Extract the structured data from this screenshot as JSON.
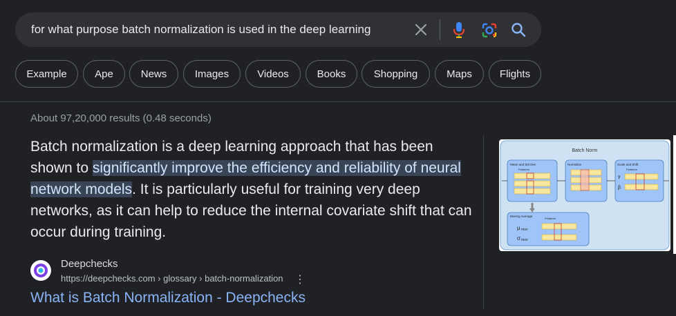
{
  "search": {
    "query": "for what purpose batch normalization is used in the deep learning",
    "clear_icon": "close-icon",
    "voice_icon": "mic-icon",
    "lens_icon": "lens-icon",
    "search_icon": "search-icon"
  },
  "chips": [
    "Example",
    "Ape",
    "News",
    "Images",
    "Videos",
    "Books",
    "Shopping",
    "Maps",
    "Flights"
  ],
  "results_stats": "About 97,20,000 results (0.48 seconds)",
  "featured_snippet": {
    "text_before": "Batch normalization is a deep learning approach that has been shown to ",
    "highlight": "significantly improve the efficiency and reliability of neural network models",
    "text_after": ". It is particularly useful for training very deep networks, as it can help to reduce the internal covariate shift that can occur during training."
  },
  "source": {
    "site_name": "Deepchecks",
    "url": "https://deepchecks.com › glossary › batch-normalization",
    "title": "What is Batch Normalization - Deepchecks"
  },
  "thumbnail": {
    "title": "Batch Norm",
    "box1": "Mean and Std Dev",
    "box2": "Normalize",
    "box3": "Scale and Shift",
    "box4": "Moving Average",
    "features": "Features",
    "gamma": "γ",
    "beta": "β",
    "mu": "μ",
    "mu_sub": "mov",
    "sigma": "σ",
    "sigma_sub": "mov"
  },
  "colors": {
    "background": "#202124",
    "link": "#8ab4f8",
    "highlight_bg": "#394457"
  }
}
